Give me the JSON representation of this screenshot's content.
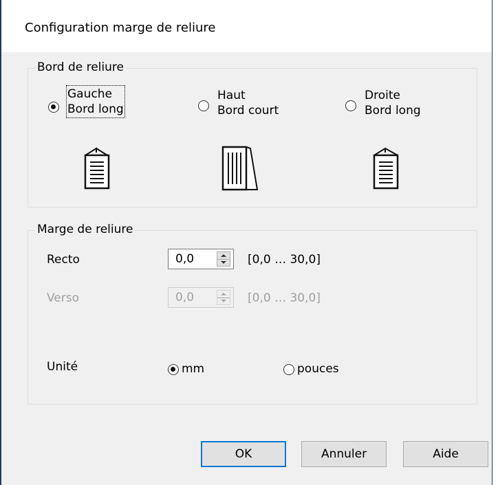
{
  "dialog": {
    "title": "Configuration marge de reliure"
  },
  "binding_edge": {
    "legend": "Bord de reliure",
    "options": [
      {
        "line1": "Gauche",
        "line2": "Bord long",
        "selected": true,
        "icon": "document-left-binding-icon"
      },
      {
        "line1": "Haut",
        "line2": "Bord court",
        "selected": false,
        "icon": "document-top-binding-icon"
      },
      {
        "line1": "Droite",
        "line2": "Bord long",
        "selected": false,
        "icon": "document-right-binding-icon"
      }
    ]
  },
  "binding_margin": {
    "legend": "Marge de reliure",
    "recto": {
      "label": "Recto",
      "value": "0,0",
      "range": "[0,0 … 30,0]"
    },
    "verso": {
      "label": "Verso",
      "value": "0,0",
      "range": "[0,0 … 30,0]",
      "disabled": true
    },
    "unit": {
      "label": "Unité",
      "options": [
        {
          "label": "mm",
          "selected": true
        },
        {
          "label": "pouces",
          "selected": false
        }
      ]
    }
  },
  "buttons": {
    "ok": "OK",
    "cancel": "Annuler",
    "help": "Aide"
  },
  "colors": {
    "window_border": "#1c3b63",
    "default_button": "#0078d7",
    "disabled_text": "#a0a0a0"
  }
}
